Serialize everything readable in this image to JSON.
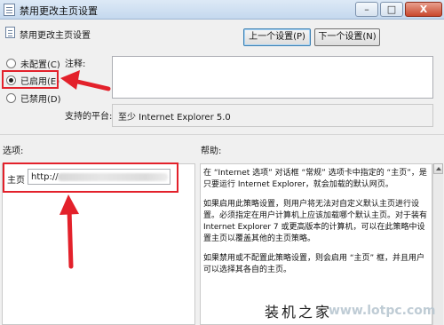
{
  "window": {
    "title": "禁用更改主页设置",
    "controls": {
      "minimize": "–",
      "maximize": "□",
      "close": "X"
    }
  },
  "header": {
    "policy_name": "禁用更改主页设置",
    "prev_button": "上一个设置(P)",
    "next_button": "下一个设置(N)"
  },
  "state_options": [
    {
      "label": "未配置(C)",
      "checked": false
    },
    {
      "label": "已启用(E)",
      "checked": true
    },
    {
      "label": "已禁用(D)",
      "checked": false
    }
  ],
  "comment": {
    "label": "注释:",
    "value": ""
  },
  "platform": {
    "label": "支持的平台:",
    "value": "至少 Internet Explorer 5.0"
  },
  "options": {
    "label": "选项:",
    "home_label": "主页",
    "home_value": "http://"
  },
  "help": {
    "label": "帮助:",
    "paragraphs": [
      "在 “Internet 选项” 对话框 “常规” 选项卡中指定的 “主页”，是只要运行 Internet Explorer，就会加载的默认网页。",
      "如果启用此策略设置，则用户将无法对自定义默认主页进行设置。必须指定在用户计算机上应该加载哪个默认主页。对于装有 Internet Explorer 7 或更高版本的计算机，可以在此策略中设置主页以覆盖其他的主页策略。",
      "如果禁用或不配置此策略设置，则会启用 “主页” 框，并且用户可以选择其各自的主页。"
    ]
  },
  "watermark": {
    "text": "装机之家",
    "url": "www.lotpc.com"
  },
  "colors": {
    "annotation_red": "#e3212b"
  },
  "icons": [
    "policy-icon",
    "close-icon",
    "minimize-icon",
    "maximize-icon",
    "red-arrow"
  ]
}
